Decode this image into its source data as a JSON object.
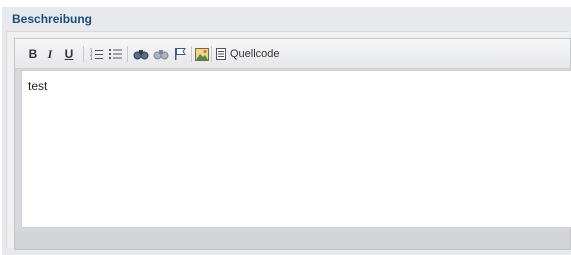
{
  "panel": {
    "title": "Beschreibung"
  },
  "toolbar": {
    "bold_label": "B",
    "italic_label": "I",
    "underline_label": "U",
    "source_label": "Quellcode",
    "icons": [
      "bold-icon",
      "italic-icon",
      "underline-icon",
      "ordered-list-icon",
      "unordered-list-icon",
      "find-icon",
      "replace-icon",
      "anchor-flag-icon",
      "image-icon",
      "source-icon"
    ]
  },
  "editor": {
    "content": "test"
  },
  "colors": {
    "title": "#1b4d7a",
    "panel_bg": "#e8e9ec",
    "toolbar_bg": "#eeeff1"
  }
}
